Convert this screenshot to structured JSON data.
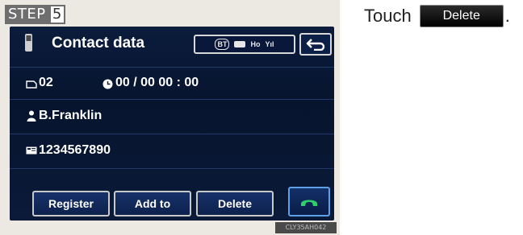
{
  "step": {
    "word": "STEP",
    "number": "5"
  },
  "screen": {
    "title": "Contact data",
    "status": {
      "bt": "BT",
      "ho": "Ho",
      "signal": "Yıl"
    },
    "rows": [
      {
        "icon": "sim-card-icon",
        "text": "02",
        "extra_icon": "clock-icon",
        "extra_text": "00 / 00  00 : 00"
      },
      {
        "icon": "person-icon",
        "text": "B.Franklin"
      },
      {
        "icon": "phone-number-icon",
        "text": "1234567890"
      }
    ],
    "buttons": {
      "register": "Register",
      "add_to": "Add to",
      "delete": "Delete"
    }
  },
  "image_code": "CLY35AH042",
  "instruction": {
    "touch": "Touch",
    "button_label": "Delete",
    "period": "."
  },
  "colors": {
    "screen_bg": "#07142e",
    "accent_blue": "#5ea0e8",
    "call_green": "#2fd06a"
  }
}
